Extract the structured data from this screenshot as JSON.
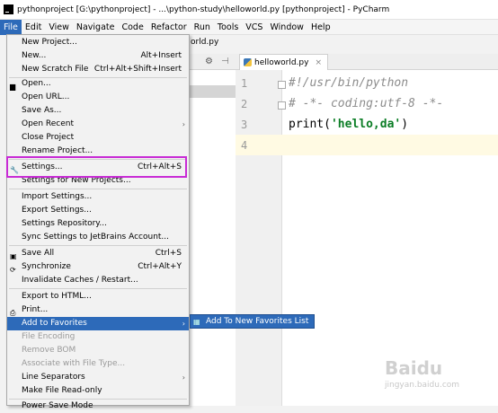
{
  "window": {
    "title": "pythonproject [G:\\pythonproject] - ...\\python-study\\helloworld.py [pythonproject] - PyCharm"
  },
  "menubar": [
    "File",
    "Edit",
    "View",
    "Navigate",
    "Code",
    "Refactor",
    "Run",
    "Tools",
    "VCS",
    "Window",
    "Help"
  ],
  "breadcrumb": "orld.py",
  "editor": {
    "tab_label": "helloworld.py",
    "line_numbers": [
      "1",
      "2",
      "3",
      "4"
    ],
    "lines": [
      "#!/usr/bin/python",
      "# -*- coding:utf-8 -*-",
      "print(",
      "'hello,da'",
      ")"
    ]
  },
  "file_menu": {
    "items": [
      {
        "label": "New Project...",
        "shortcut": ""
      },
      {
        "label": "New...",
        "shortcut": "Alt+Insert"
      },
      {
        "label": "New Scratch File",
        "shortcut": "Ctrl+Alt+Shift+Insert"
      },
      {
        "label": "Open...",
        "shortcut": ""
      },
      {
        "label": "Open URL...",
        "shortcut": ""
      },
      {
        "label": "Save As...",
        "shortcut": ""
      },
      {
        "label": "Open Recent",
        "shortcut": ""
      },
      {
        "label": "Close Project",
        "shortcut": ""
      },
      {
        "label": "Rename Project...",
        "shortcut": ""
      },
      {
        "label": "Settings...",
        "shortcut": "Ctrl+Alt+S"
      },
      {
        "label": "Settings for New Projects...",
        "shortcut": ""
      },
      {
        "label": "Import Settings...",
        "shortcut": ""
      },
      {
        "label": "Export Settings...",
        "shortcut": ""
      },
      {
        "label": "Settings Repository...",
        "shortcut": ""
      },
      {
        "label": "Sync Settings to JetBrains Account...",
        "shortcut": ""
      },
      {
        "label": "Save All",
        "shortcut": "Ctrl+S"
      },
      {
        "label": "Synchronize",
        "shortcut": "Ctrl+Alt+Y"
      },
      {
        "label": "Invalidate Caches / Restart...",
        "shortcut": ""
      },
      {
        "label": "Export to HTML...",
        "shortcut": ""
      },
      {
        "label": "Print...",
        "shortcut": ""
      },
      {
        "label": "Add to Favorites",
        "shortcut": ""
      },
      {
        "label": "File Encoding",
        "shortcut": ""
      },
      {
        "label": "Remove BOM",
        "shortcut": ""
      },
      {
        "label": "Associate with File Type...",
        "shortcut": ""
      },
      {
        "label": "Line Separators",
        "shortcut": ""
      },
      {
        "label": "Make File Read-only",
        "shortcut": ""
      },
      {
        "label": "Power Save Mode",
        "shortcut": ""
      }
    ]
  },
  "submenu": {
    "label": "Add To New Favorites List"
  },
  "watermark": {
    "logo": "Baidu",
    "sub": "jingyan.baidu.com"
  }
}
